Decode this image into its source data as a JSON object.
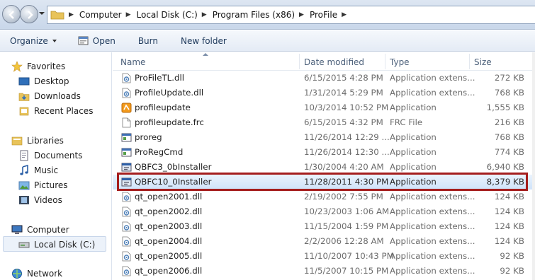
{
  "address": {
    "crumbs": [
      "Computer",
      "Local Disk (C:)",
      "Program Files (x86)",
      "ProFile"
    ]
  },
  "toolbar": {
    "organize": "Organize",
    "open": "Open",
    "burn": "Burn",
    "new_folder": "New folder"
  },
  "nav": {
    "favorites": "Favorites",
    "desktop": "Desktop",
    "downloads": "Downloads",
    "recent": "Recent Places",
    "libraries": "Libraries",
    "documents": "Documents",
    "music": "Music",
    "pictures": "Pictures",
    "videos": "Videos",
    "computer": "Computer",
    "local_disk": "Local Disk (C:)",
    "network": "Network"
  },
  "columns": {
    "name": "Name",
    "date": "Date modified",
    "type": "Type",
    "size": "Size"
  },
  "files": [
    {
      "name": "ProFileTL.dll",
      "date": "6/15/2015 4:28 PM",
      "type": "Application extens...",
      "size": "272 KB",
      "icon": "dll-icon"
    },
    {
      "name": "ProfileUpdate.dll",
      "date": "1/31/2014 5:29 PM",
      "type": "Application extens...",
      "size": "768 KB",
      "icon": "dll-icon"
    },
    {
      "name": "profileupdate",
      "date": "10/3/2014 10:52 PM",
      "type": "Application",
      "size": "1,555 KB",
      "icon": "app-orange-icon"
    },
    {
      "name": "profileupdate.frc",
      "date": "6/15/2015 4:32 PM",
      "type": "FRC File",
      "size": "216 KB",
      "icon": "blank-file-icon"
    },
    {
      "name": "proreg",
      "date": "11/26/2014 12:29 ...",
      "type": "Application",
      "size": "768 KB",
      "icon": "app-window-icon"
    },
    {
      "name": "ProRegCmd",
      "date": "11/26/2014 12:30 ...",
      "type": "Application",
      "size": "774 KB",
      "icon": "app-window-icon"
    },
    {
      "name": "QBFC3_0bInstaller",
      "date": "1/30/2004 4:20 AM",
      "type": "Application",
      "size": "6,940 KB",
      "icon": "installer-icon"
    },
    {
      "name": "QBFC10_0Installer",
      "date": "11/28/2011 4:30 PM",
      "type": "Application",
      "size": "8,379 KB",
      "icon": "installer-icon"
    },
    {
      "name": "qt_open2001.dll",
      "date": "2/19/2002 7:55 PM",
      "type": "Application extens...",
      "size": "124 KB",
      "icon": "dll-icon"
    },
    {
      "name": "qt_open2002.dll",
      "date": "10/23/2003 1:06 AM",
      "type": "Application extens...",
      "size": "124 KB",
      "icon": "dll-icon"
    },
    {
      "name": "qt_open2003.dll",
      "date": "11/15/2004 1:59 PM",
      "type": "Application extens...",
      "size": "124 KB",
      "icon": "dll-icon"
    },
    {
      "name": "qt_open2004.dll",
      "date": "2/2/2006 12:28 AM",
      "type": "Application extens...",
      "size": "124 KB",
      "icon": "dll-icon"
    },
    {
      "name": "qt_open2005.dll",
      "date": "11/10/2007 10:43 PM",
      "type": "Application extens...",
      "size": "92 KB",
      "icon": "dll-icon"
    },
    {
      "name": "qt_open2006.dll",
      "date": "11/5/2007 10:15 PM",
      "type": "Application extens...",
      "size": "92 KB",
      "icon": "dll-icon"
    }
  ],
  "selected_index": 7
}
